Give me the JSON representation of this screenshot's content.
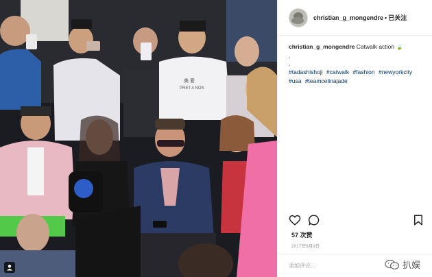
{
  "post": {
    "username": "christian_g_mongendre",
    "separator": "•",
    "follow_status": "已关注",
    "caption_text": "Catwalk action 🍃",
    "caption_dots": [
      ".",
      "."
    ],
    "hashtags": [
      "#tadashishoji",
      "#catwalk",
      "#fashion",
      "#newyorkcity",
      "#usa",
      "#teamcelinajade"
    ],
    "likes": "57 次赞",
    "date": "2017年9月9日",
    "comment_placeholder": "添加评论..."
  },
  "photo": {
    "shirt_text_line1": "美 爱",
    "shirt_text_line2": "PRET A NOS"
  },
  "watermark": {
    "text": "扒娱"
  },
  "icons": {
    "like": "heart-icon",
    "comment": "comment-icon",
    "save": "bookmark-icon",
    "tagged": "tagged-user-icon",
    "watermark": "wechat-logo-icon"
  }
}
